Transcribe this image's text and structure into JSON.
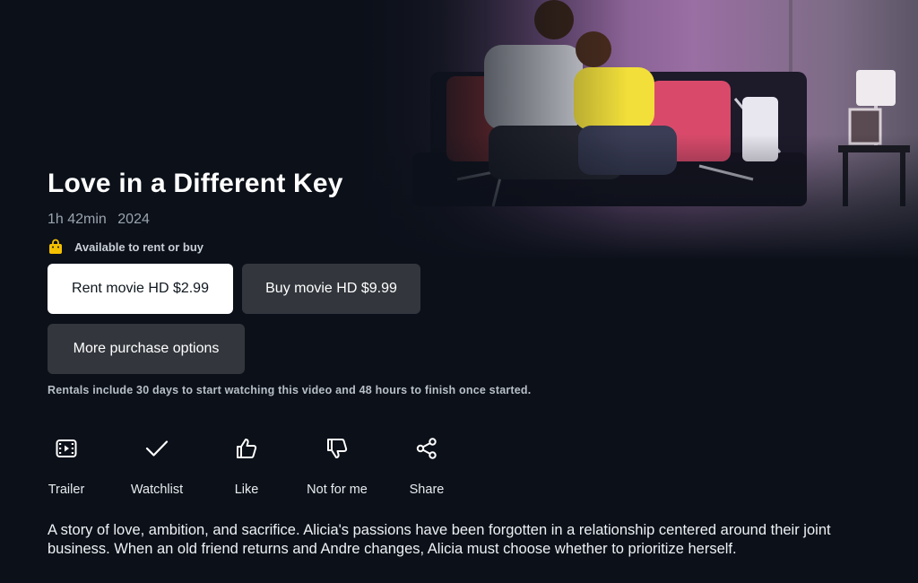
{
  "title": "Love in a Different Key",
  "meta": {
    "duration": "1h 42min",
    "year": "2024"
  },
  "availability": {
    "icon": "shopping-bag-icon",
    "text": "Available to rent or buy"
  },
  "buttons": {
    "rent": "Rent movie HD $2.99",
    "buy": "Buy movie HD $9.99",
    "more": "More purchase options"
  },
  "rental_note": "Rentals include 30 days to start watching this video and 48 hours to finish once started.",
  "actions": [
    {
      "label": "Trailer",
      "icon": "trailer-icon"
    },
    {
      "label": "Watchlist",
      "icon": "checkmark-icon"
    },
    {
      "label": "Like",
      "icon": "thumbs-up-icon"
    },
    {
      "label": "Not for me",
      "icon": "thumbs-down-icon"
    },
    {
      "label": "Share",
      "icon": "share-icon"
    }
  ],
  "description": "A story of love, ambition, and sacrifice. Alicia's passions have been forgotten in a relationship centered around their joint business. When an old friend returns and Andre changes, Alicia must choose whether to prioritize herself.",
  "colors": {
    "background": "#0b1019",
    "primary_button": "#ffffff",
    "secondary_button": "#33373d",
    "muted_text": "#9aa3ad",
    "bag_icon": "#f5c000"
  }
}
